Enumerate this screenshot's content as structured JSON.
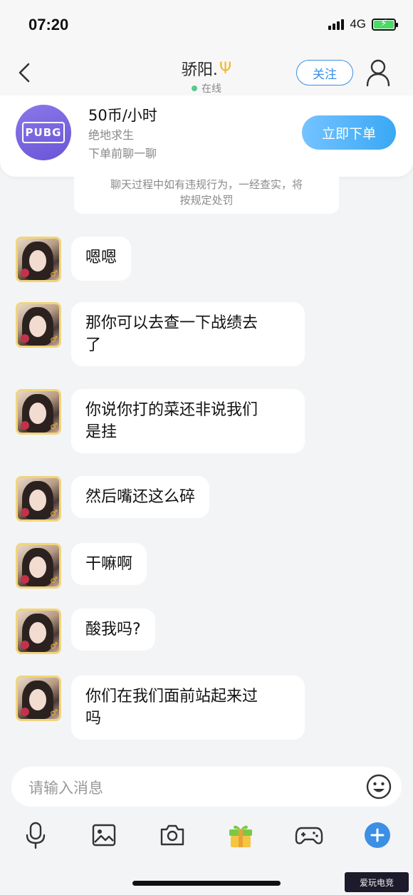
{
  "status_bar": {
    "time": "07:20",
    "network": "4G"
  },
  "header": {
    "title": "骄阳.",
    "title_icon": "trident-icon",
    "status": "在线",
    "follow_label": "关注"
  },
  "service": {
    "logo_text": "PUBG",
    "price": "50币/小时",
    "game": "绝地求生",
    "hint": "下单前聊一聊",
    "order_label": "立即下单"
  },
  "notice": {
    "line1": "聊天过程中如有违规行为，一经查实，将",
    "line2": "按规定处罚"
  },
  "messages": [
    {
      "line1": "嗯嗯",
      "line2": ""
    },
    {
      "line1": "那你可以去查一下战绩去",
      "line2": "了"
    },
    {
      "line1": "你说你打的菜还非说我们",
      "line2": "是挂"
    },
    {
      "line1": "然后嘴还这么碎",
      "line2": ""
    },
    {
      "line1": "干嘛啊",
      "line2": ""
    },
    {
      "line1": "酸我吗?",
      "line2": ""
    },
    {
      "line1": "你们在我们面前站起来过",
      "line2": "吗"
    }
  ],
  "input": {
    "placeholder": "请输入消息"
  },
  "toolbar": {
    "items": [
      "microphone-icon",
      "image-icon",
      "camera-icon",
      "gift-icon",
      "gamepad-icon",
      "plus-icon"
    ]
  },
  "watermark": {
    "text": "爱玩电竞"
  },
  "colors": {
    "accent": "#3b8fe4",
    "order_button": "#3aa8f4",
    "online": "#57c98a",
    "background": "#f3f4f6"
  }
}
